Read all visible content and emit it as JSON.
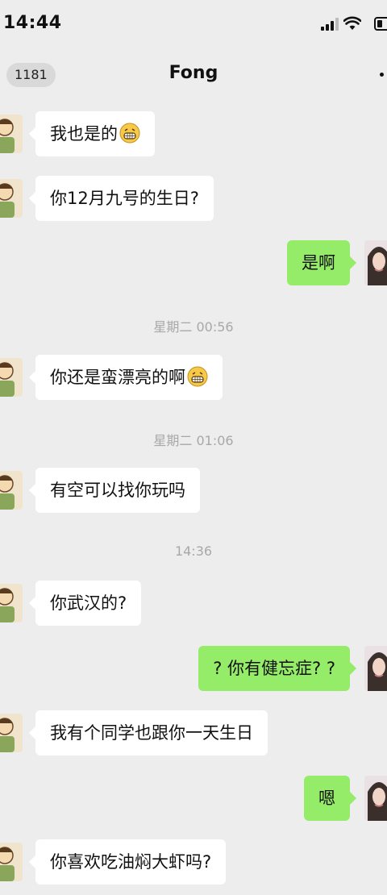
{
  "status_bar": {
    "time": "14:44"
  },
  "nav": {
    "unread_count": "1181",
    "title": "Fong"
  },
  "messages": [
    {
      "side": "left",
      "text": "我也是的",
      "emoji": "grin-emoji"
    },
    {
      "side": "left",
      "text": "你12月九号的生日?"
    },
    {
      "side": "right",
      "text": "是啊"
    },
    {
      "type": "time",
      "text": "星期二 00:56"
    },
    {
      "side": "left",
      "text": "你还是蛮漂亮的啊",
      "emoji": "grin-emoji"
    },
    {
      "type": "time",
      "text": "星期二 01:06"
    },
    {
      "side": "left",
      "text": "有空可以找你玩吗"
    },
    {
      "type": "time",
      "text": "14:36"
    },
    {
      "side": "left",
      "text": "你武汉的?"
    },
    {
      "side": "right",
      "text": "? 你有健忘症? ?"
    },
    {
      "side": "left",
      "text": "我有个同学也跟你一天生日"
    },
    {
      "side": "right",
      "text": "嗯"
    },
    {
      "side": "left",
      "text": "你喜欢吃油焖大虾吗?"
    }
  ],
  "colors": {
    "background": "#ededed",
    "sent_bubble": "#95ec69",
    "received_bubble": "#ffffff",
    "timestamp": "#a8a8a8"
  }
}
